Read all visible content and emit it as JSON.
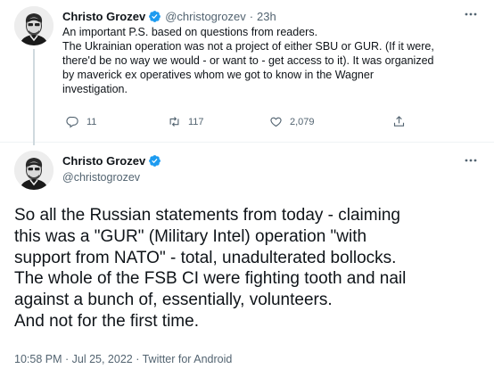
{
  "colors": {
    "verified_badge": "#1d9bf0",
    "secondary_text": "#536471",
    "thread_line": "#cfd9de"
  },
  "parent_tweet": {
    "author_name": "Christo Grozev",
    "handle": "@christogrozev",
    "separator": "·",
    "time": "23h",
    "more_icon": "more-horizontal-icon",
    "text_lines": [
      "An important P.S. based on questions from readers.",
      "The Ukrainian operation was not a project of either SBU or GUR. (If it were,",
      "there'd be no way we would - or want to - get access to it). It was organized",
      "by maverick ex operatives whom we got to know in the Wagner",
      "investigation."
    ],
    "actions": {
      "replies": "11",
      "retweets": "117",
      "likes": "2,079"
    }
  },
  "main_tweet": {
    "author_name": "Christo Grozev",
    "handle": "@christogrozev",
    "text_lines": [
      "So all the Russian statements from today - claiming",
      "this was a \"GUR\" (Military Intel) operation \"with",
      "support from NATO\" - total, unadulterated bollocks.",
      "The whole of the FSB CI were fighting tooth and nail",
      "against a bunch of, essentially, volunteers.",
      "And not for the first time."
    ],
    "meta": "10:58 PM · Jul 25, 2022 · Twitter for Android"
  }
}
